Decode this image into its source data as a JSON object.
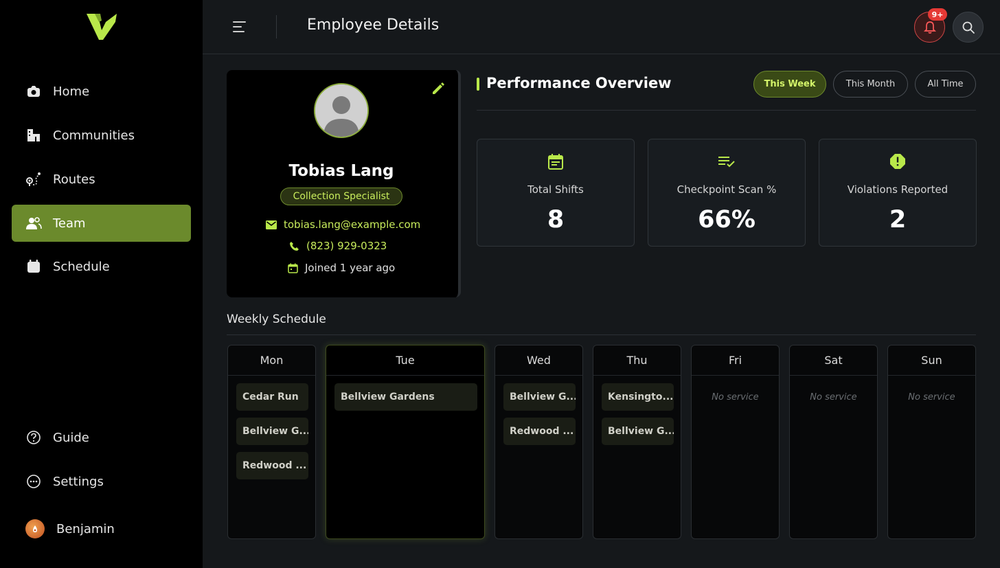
{
  "sidebar": {
    "items": [
      {
        "label": "Home",
        "icon": "camera-home-icon"
      },
      {
        "label": "Communities",
        "icon": "building-icon"
      },
      {
        "label": "Routes",
        "icon": "route-icon"
      },
      {
        "label": "Team",
        "icon": "team-icon",
        "active": true
      },
      {
        "label": "Schedule",
        "icon": "calendar-icon"
      }
    ],
    "bottom_items": [
      {
        "label": "Guide",
        "icon": "help-icon"
      },
      {
        "label": "Settings",
        "icon": "settings-dots-icon"
      }
    ],
    "user": {
      "name": "Benjamin"
    }
  },
  "header": {
    "title": "Employee Details",
    "notification_badge": "9+"
  },
  "profile": {
    "name": "Tobias Lang",
    "role": "Collection Specialist",
    "email": "tobias.lang@example.com",
    "phone": "(823) 929-0323",
    "joined": "Joined 1 year ago"
  },
  "performance": {
    "title": "Performance Overview",
    "filters": [
      {
        "label": "This Week",
        "active": true
      },
      {
        "label": "This Month",
        "active": false
      },
      {
        "label": "All Time",
        "active": false
      }
    ],
    "stats": [
      {
        "label": "Total Shifts",
        "value": "8",
        "icon": "calendar-note-icon"
      },
      {
        "label": "Checkpoint Scan %",
        "value": "66%",
        "icon": "checklist-icon"
      },
      {
        "label": "Violations Reported",
        "value": "2",
        "icon": "alert-icon"
      }
    ]
  },
  "schedule": {
    "title": "Weekly Schedule",
    "days": [
      {
        "day": "Mon",
        "shifts": [
          "Cedar Run",
          "Bellview G...",
          "Redwood ..."
        ]
      },
      {
        "day": "Tue",
        "shifts": [
          "Bellview Gardens"
        ],
        "today": true
      },
      {
        "day": "Wed",
        "shifts": [
          "Bellview G...",
          "Redwood ..."
        ]
      },
      {
        "day": "Thu",
        "shifts": [
          "Kensingto...",
          "Bellview G..."
        ]
      },
      {
        "day": "Fri",
        "shifts": [],
        "empty_label": "No service"
      },
      {
        "day": "Sat",
        "shifts": [],
        "empty_label": "No service"
      },
      {
        "day": "Sun",
        "shifts": [],
        "empty_label": "No service"
      }
    ]
  },
  "colors": {
    "accent": "#b9e84a",
    "active_nav": "#6b8a2c",
    "alert": "#e53935"
  }
}
